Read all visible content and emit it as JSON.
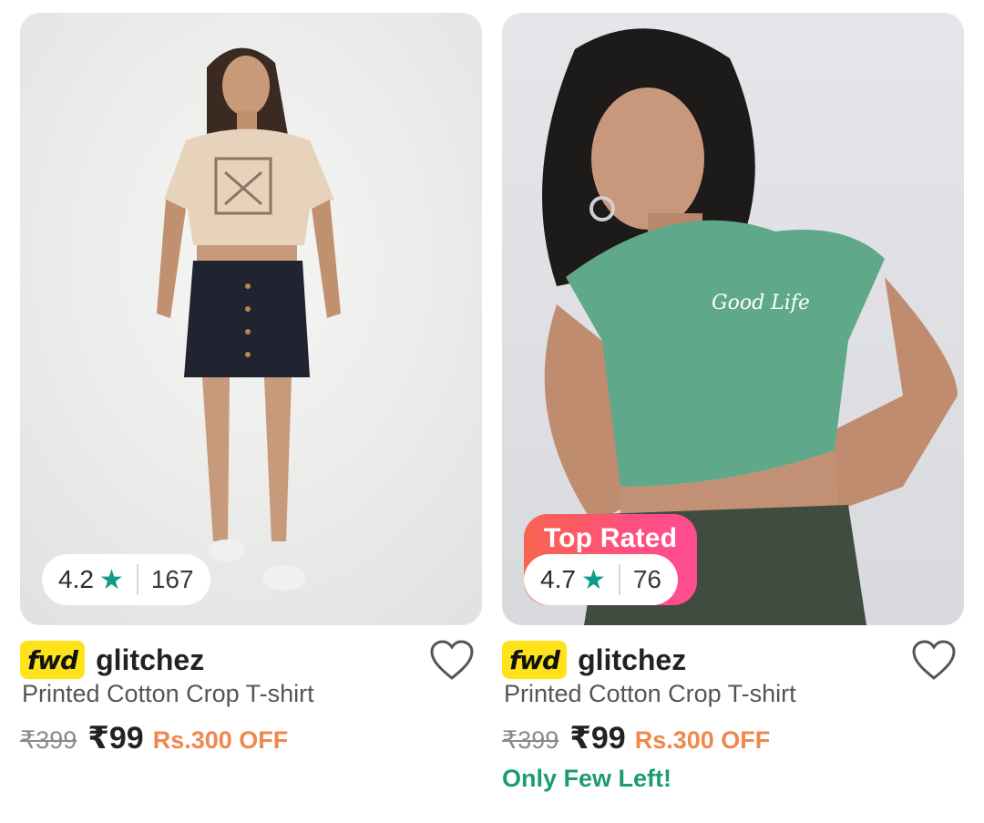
{
  "products": [
    {
      "rating": "4.2",
      "rating_count": "167",
      "fwd_tag": "fwd",
      "brand": "glitchez",
      "title": "Printed Cotton Crop T-shirt",
      "mrp": "₹399",
      "price": "₹99",
      "discount": "Rs.300 OFF",
      "tshirt_color": "#e7d3bb",
      "skirt_color": "#1f2430"
    },
    {
      "badge": "Top Rated",
      "rating": "4.7",
      "rating_count": "76",
      "fwd_tag": "fwd",
      "brand": "glitchez",
      "title": "Printed Cotton Crop T-shirt",
      "mrp": "₹399",
      "price": "₹99",
      "discount": "Rs.300 OFF",
      "stock_label": "Only Few Left!",
      "shirt_print": "Good Life",
      "tshirt_color": "#5fa88a",
      "pants_color": "#3f4c3f"
    }
  ],
  "colors": {
    "accent_star": "#109b89",
    "discount": "#f2874d",
    "stock": "#1b9e6b",
    "fwd_yellow": "#ffe31a"
  }
}
